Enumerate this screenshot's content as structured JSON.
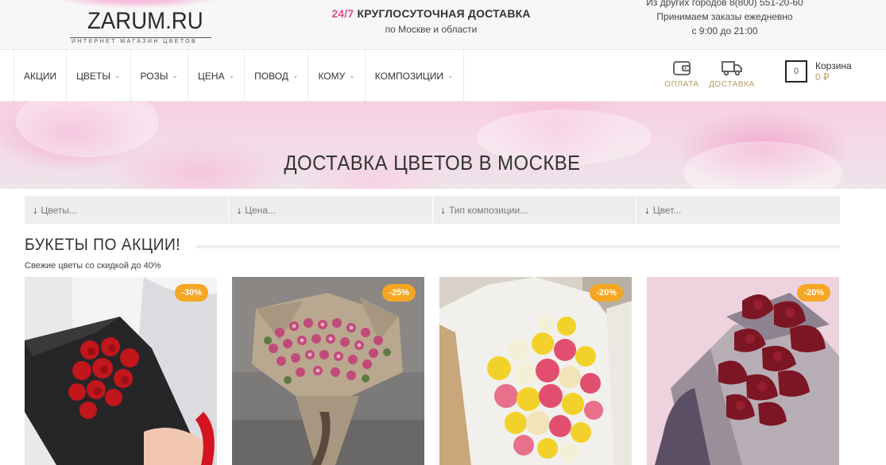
{
  "header": {
    "logo": {
      "text": "ZARUM.RU",
      "subtitle": "ИНТЕРНЕТ МАГАЗИН ЦВЕТОВ"
    },
    "delivery": {
      "accent": "24/7",
      "title": "КРУГЛОСУТОЧНАЯ ДОСТАВКА",
      "subtitle": "по Москве и области"
    },
    "contact": {
      "line1": "Из других городов 8(800) 551-20-60",
      "line2": "Принимаем заказы ежедневно",
      "line3": "с 9:00 до 21:00"
    }
  },
  "nav": {
    "items": [
      {
        "label": "АКЦИИ",
        "dropdown": false
      },
      {
        "label": "ЦВЕТЫ",
        "dropdown": true
      },
      {
        "label": "РОЗЫ",
        "dropdown": true
      },
      {
        "label": "ЦЕНА",
        "dropdown": true
      },
      {
        "label": "ПОВОД",
        "dropdown": true
      },
      {
        "label": "КОМУ",
        "dropdown": true
      },
      {
        "label": "КОМПОЗИЦИИ",
        "dropdown": true
      }
    ],
    "utilities": [
      {
        "label": "ОПЛАТА",
        "icon": "wallet-icon"
      },
      {
        "label": "ДОСТАВКА",
        "icon": "truck-icon"
      }
    ],
    "cart": {
      "title": "Корзина",
      "count": "0",
      "sum": "0 ₽"
    }
  },
  "banner": {
    "title": "ДОСТАВКА ЦВЕТОВ В МОСКВЕ"
  },
  "filters": [
    {
      "placeholder": "Цветы..."
    },
    {
      "placeholder": "Цена..."
    },
    {
      "placeholder": "Тип композиции..."
    },
    {
      "placeholder": "Цвет..."
    }
  ],
  "section": {
    "title": "БУКЕТЫ ПО АКЦИИ!",
    "subtitle": "Свежие цветы со скидкой до 40%"
  },
  "products": [
    {
      "discount": "-30%"
    },
    {
      "discount": "-25%"
    },
    {
      "discount": "-20%"
    },
    {
      "discount": "-20%"
    }
  ],
  "colors": {
    "accent_pink": "#e0508c",
    "gold": "#b89a62",
    "badge_orange": "#f5a623"
  }
}
